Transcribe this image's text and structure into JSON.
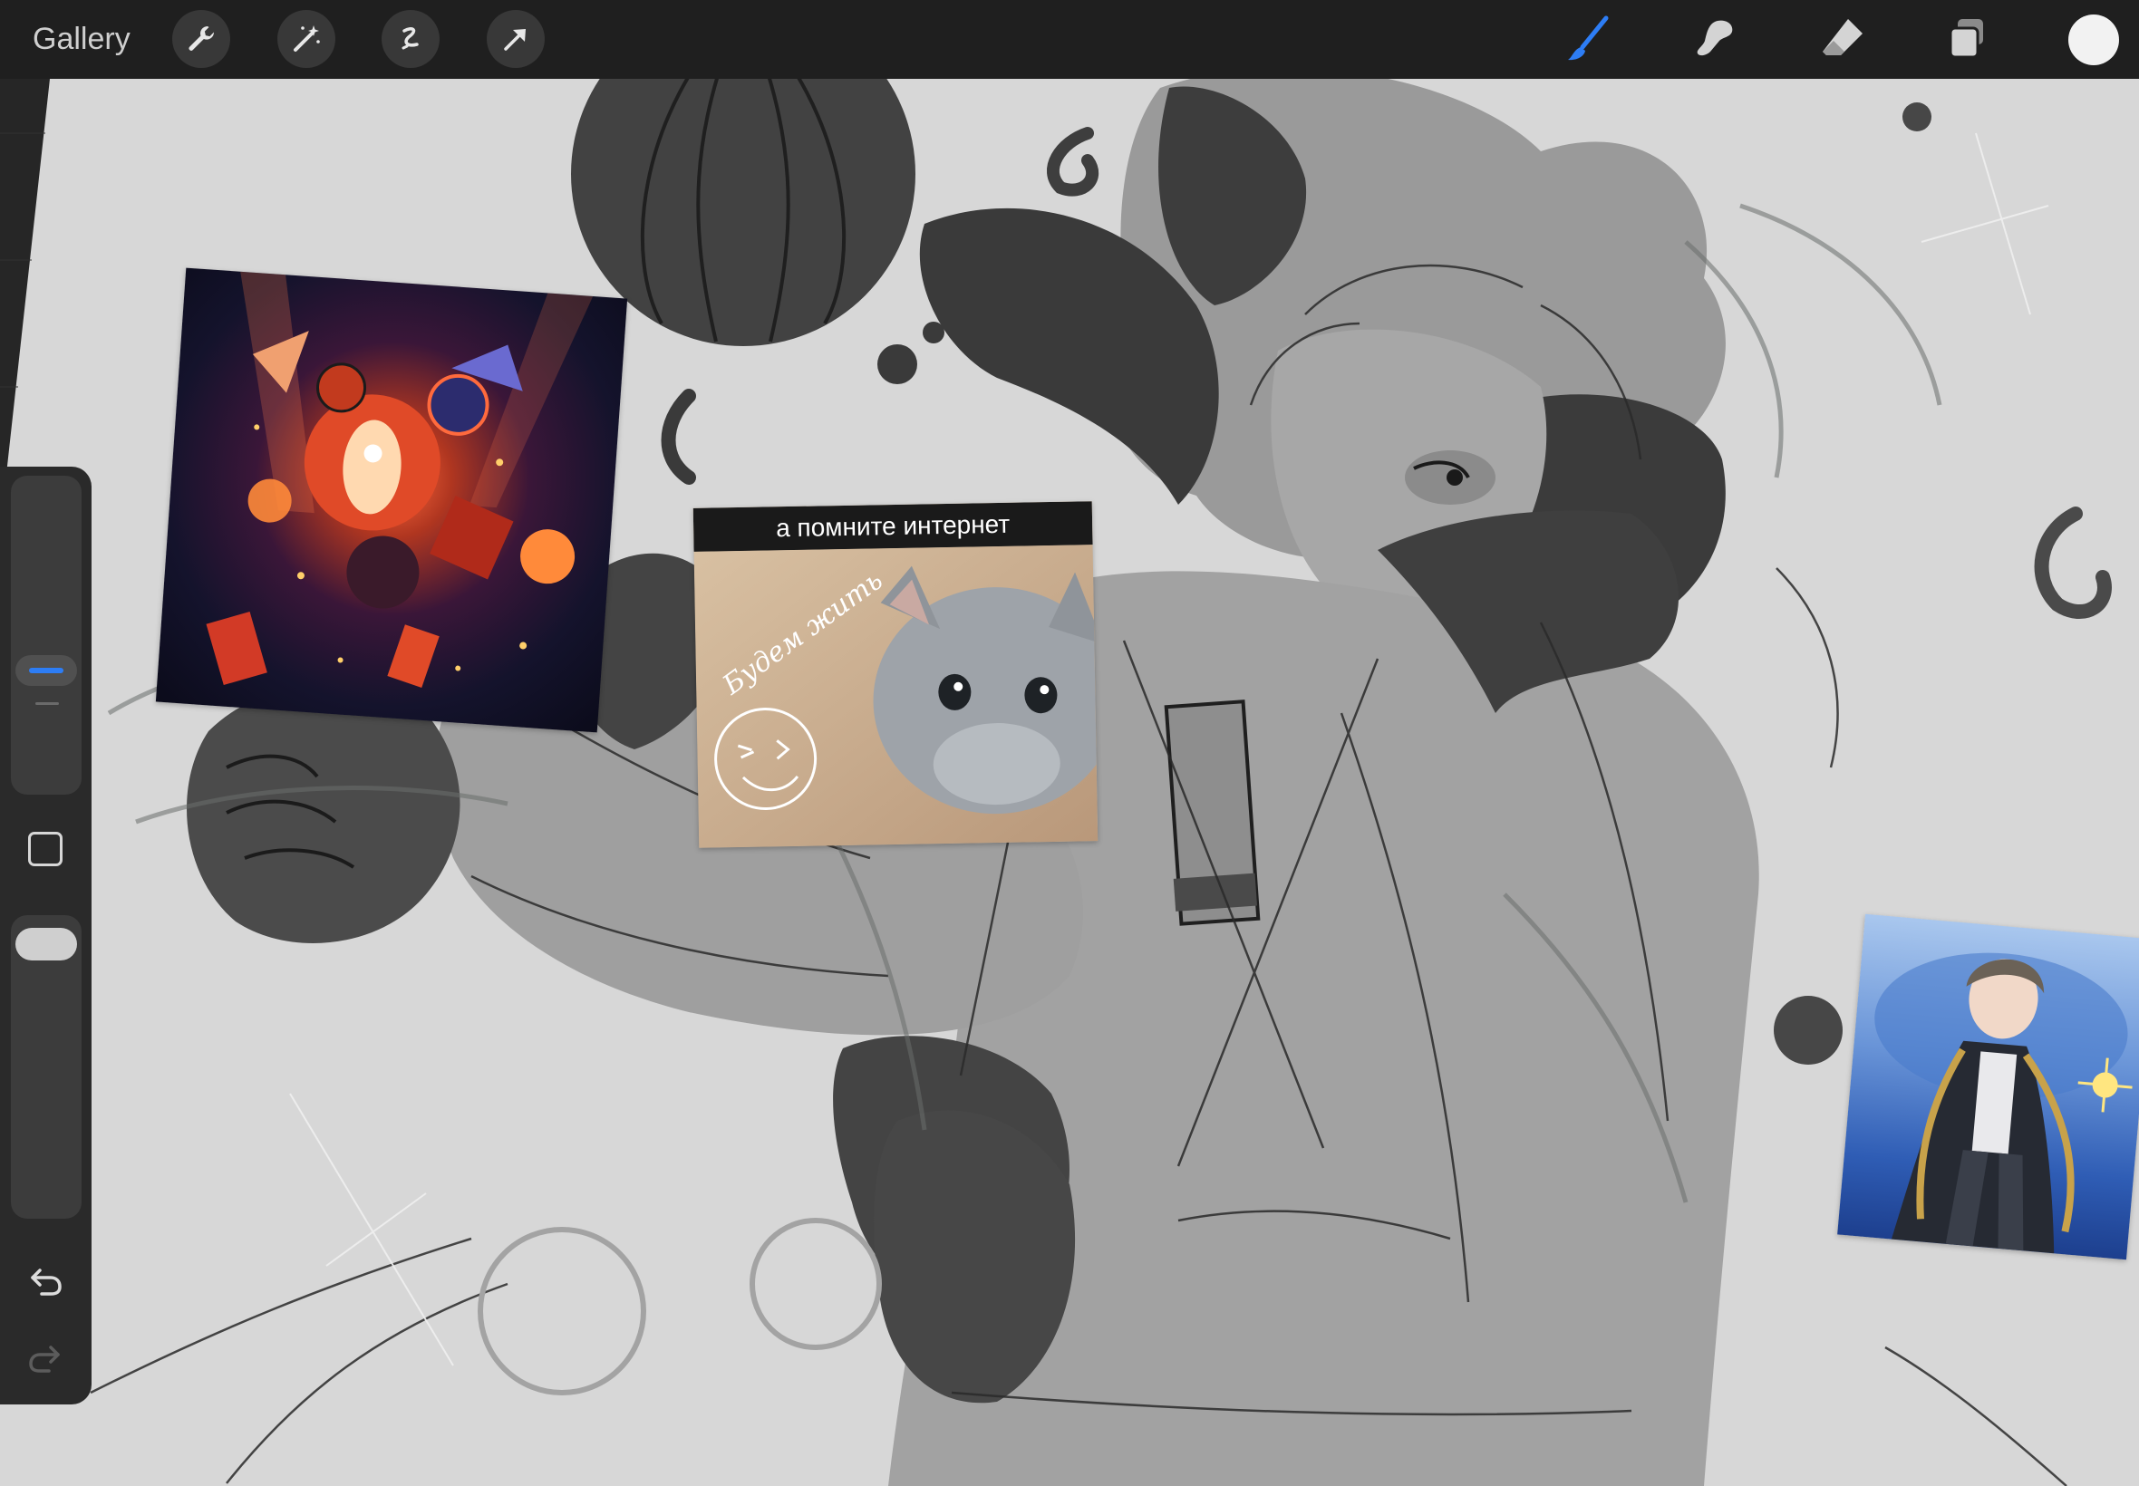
{
  "topbar": {
    "gallery_label": "Gallery",
    "left_tools": [
      "wrench-icon",
      "magic-wand-icon",
      "selection-icon",
      "transform-arrow-icon"
    ],
    "right_tools": [
      "brush-icon",
      "smudge-icon",
      "eraser-icon",
      "layers-icon"
    ],
    "active_tool": "brush",
    "current_color": "#f2f2f2",
    "accent_color": "#2d7df5"
  },
  "sidebar": {
    "brush_size_level": 0.55,
    "opacity_level": 1.0,
    "modifier_button": "square-modifier-icon",
    "undo": "undo-icon",
    "redo": "redo-icon"
  },
  "canvas": {
    "background_color": "#d6d6d6",
    "references": {
      "poster": "dark circus poster artwork",
      "cat_meme": {
        "caption": "а помните интернет",
        "handwriting": "Будем жить"
      },
      "character_art": "anime character reference"
    }
  }
}
